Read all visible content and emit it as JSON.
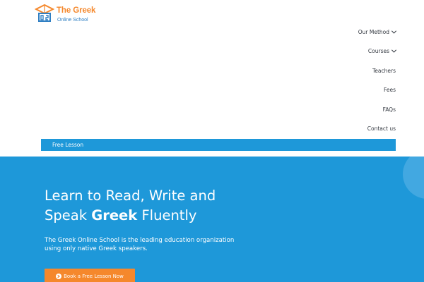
{
  "brand": {
    "line1": "The Greek",
    "line2": "Online School",
    "colors": {
      "orange": "#f5882c",
      "blue": "#2f7fc3"
    }
  },
  "nav": {
    "items": [
      {
        "label": "Our Method",
        "has_dropdown": true
      },
      {
        "label": "Courses",
        "has_dropdown": true
      },
      {
        "label": "Teachers",
        "has_dropdown": false
      },
      {
        "label": "Fees",
        "has_dropdown": false
      },
      {
        "label": "FAQs",
        "has_dropdown": false
      },
      {
        "label": "Contact us",
        "has_dropdown": false
      }
    ],
    "dropdown_icon": "chevron-down-icon"
  },
  "free_lesson_bar": {
    "label": "Free Lesson"
  },
  "hero": {
    "title_part1": "Learn to Read, Write and",
    "title_part2": "Speak ",
    "title_bold": "Greek",
    "title_part3": " Fluently",
    "description": "The Greek Online School is the leading education organization using only native Greek speakers.",
    "cta": {
      "label": "Book a Free Lesson Now",
      "icon": "arrow-right-circle-icon"
    },
    "background_color": "#1e98d9"
  }
}
